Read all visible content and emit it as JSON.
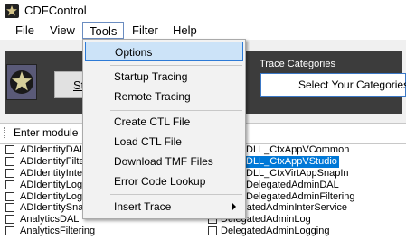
{
  "app": {
    "title": "CDFControl"
  },
  "menubar": {
    "items": [
      "File",
      "View",
      "Tools",
      "Filter",
      "Help"
    ]
  },
  "tools_menu": {
    "items": [
      "Options",
      "Startup Tracing",
      "Remote Tracing",
      "Create CTL File",
      "Load CTL File",
      "Download TMF Files",
      "Error Code Lookup",
      "Insert Trace"
    ]
  },
  "toolbar": {
    "start_label": "St",
    "trace_categories_label": "Trace Categories",
    "select_categories": "Select Your Categories"
  },
  "module": {
    "label": "Enter module"
  },
  "left_list": [
    "ADIdentityDAL",
    "ADIdentityFilte",
    "ADIdentityInte",
    "ADIdentityLog",
    "ADIdentityLog",
    "ADIdentitySnapIn",
    "AnalyticsDAL",
    "AnalyticsFiltering"
  ],
  "right_list": [
    "DLL_CtxAppVCommon",
    "DLL_CtxAppVStudio",
    "DLL_CtxVirtAppSnapIn",
    "DelegatedAdminDAL",
    "DelegatedAdminFiltering",
    "DelegatedAdminInterService",
    "DelegatedAdminLog",
    "DelegatedAdminLogging"
  ]
}
